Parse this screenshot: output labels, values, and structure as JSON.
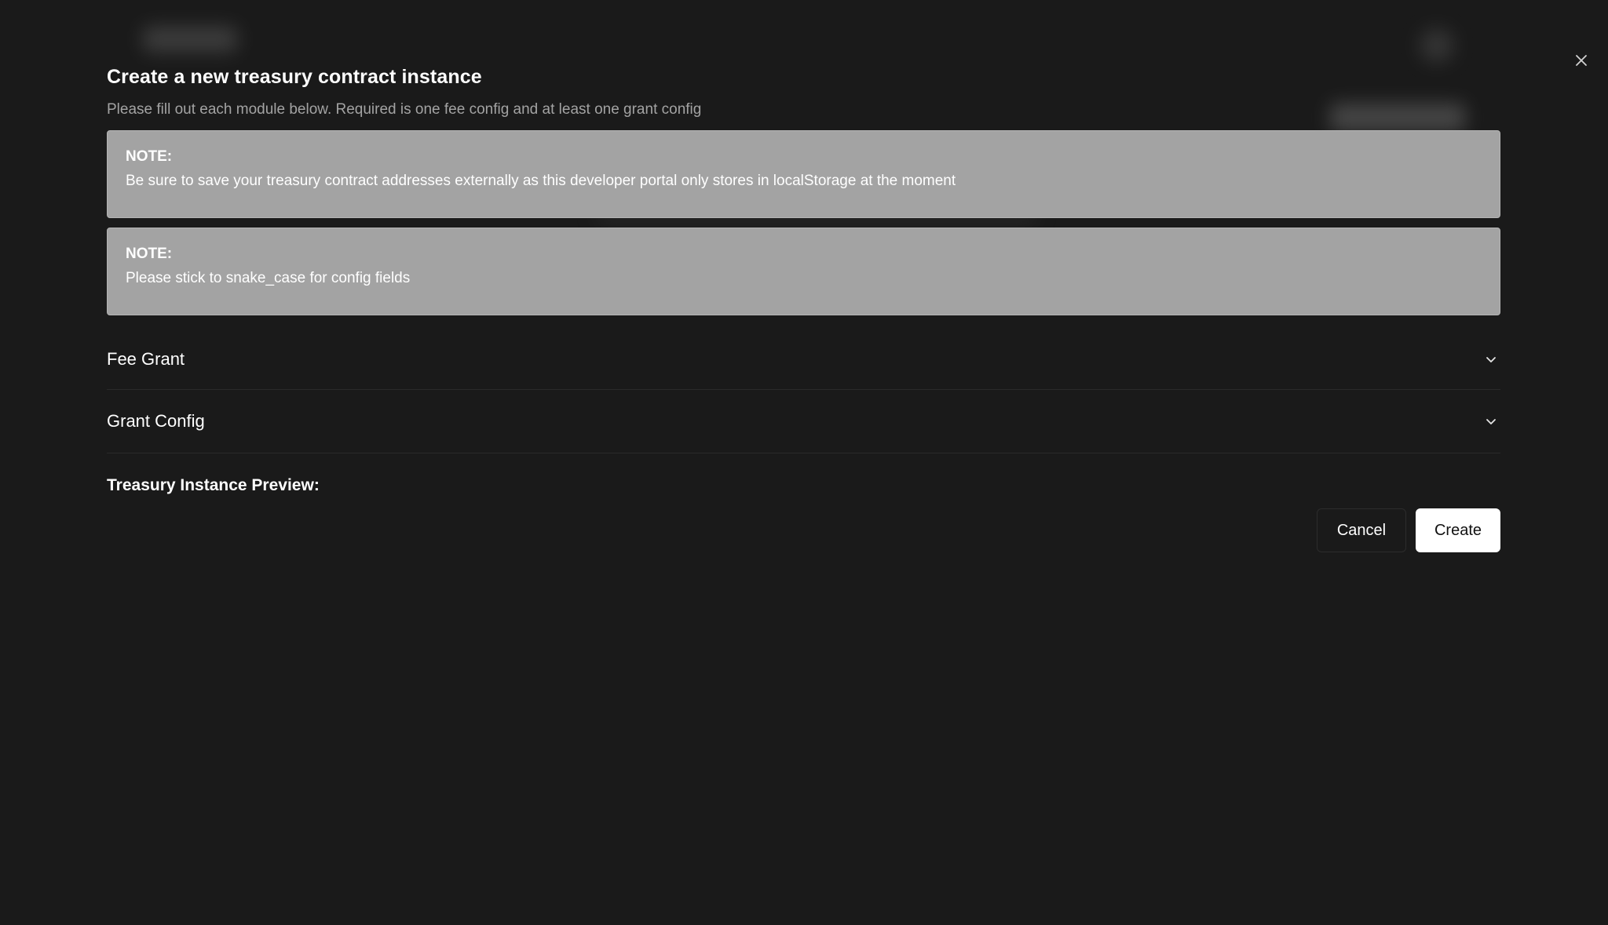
{
  "dialog": {
    "title": "Create a new treasury contract instance",
    "subtitle": "Please fill out each module below. Required is one fee config and at least one grant config",
    "notes": [
      {
        "label": "NOTE:",
        "text": "Be sure to save your treasury contract addresses externally as this developer portal only stores in localStorage at the moment"
      },
      {
        "label": "NOTE:",
        "text": "Please stick to snake_case for config fields"
      }
    ],
    "sections": [
      {
        "label": "Fee Grant",
        "icon": "chevron-down-icon"
      },
      {
        "label": "Grant Config",
        "icon": "chevron-down-icon"
      }
    ],
    "preview_label": "Treasury Instance Preview:",
    "actions": {
      "cancel_label": "Cancel",
      "create_label": "Create"
    },
    "close_icon": "close-icon"
  },
  "colors": {
    "background": "#1a1a1a",
    "note_background": "#a3a3a3",
    "subtitle_text": "#a3a3a3",
    "primary_button": "#ffffff"
  }
}
